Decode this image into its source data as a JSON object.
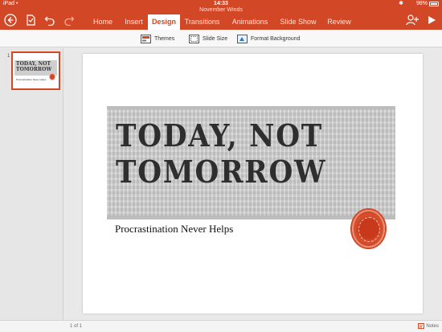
{
  "status_bar": {
    "carrier": "iPad",
    "wifi": "•",
    "time": "14:33",
    "battery_percent": "98%",
    "bluetooth": "✱"
  },
  "document": {
    "title": "November Winds"
  },
  "toolbar": {
    "tabs": [
      "Home",
      "Insert",
      "Design",
      "Transitions",
      "Animations",
      "Slide Show",
      "Review"
    ],
    "active_tab": "Design",
    "icons": [
      "back-icon",
      "file-icon",
      "undo-icon",
      "redo-icon",
      "share-icon",
      "play-icon"
    ]
  },
  "ribbon": {
    "themes": "Themes",
    "slide_size": "Slide Size",
    "format_background": "Format Background"
  },
  "thumbnails": [
    {
      "number": "1",
      "title_line1": "TODAY, NOT",
      "title_line2": "TOMORROW",
      "subtitle": "Procrastination Never Helps"
    }
  ],
  "slide": {
    "title_line1": "TODAY, NOT",
    "title_line2": "TOMORROW",
    "subtitle": "Procrastination Never Helps"
  },
  "bottom_bar": {
    "slide_count": "1 of 1",
    "notes_label": "Notes"
  },
  "colors": {
    "accent": "#d24726"
  }
}
